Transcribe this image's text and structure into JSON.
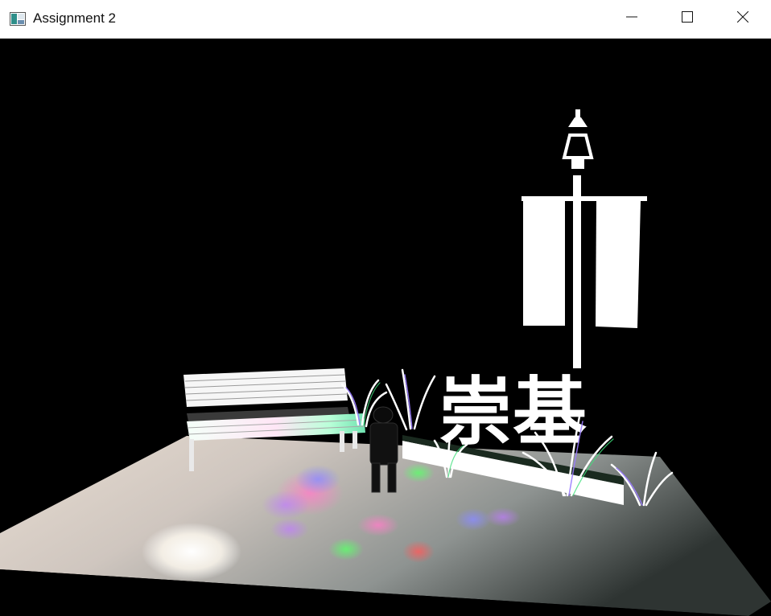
{
  "window": {
    "title": "Assignment 2",
    "app_icon": "app-window-icon",
    "controls": {
      "minimize_icon": "minimize-icon",
      "maximize_icon": "maximize-icon",
      "close_icon": "close-icon"
    }
  },
  "scene": {
    "sign_text": "崇基",
    "colors": {
      "background": "#000000",
      "floor_light": "#f4efe8",
      "floor_dark": "#2e3432",
      "sign": "#ffffff"
    }
  }
}
